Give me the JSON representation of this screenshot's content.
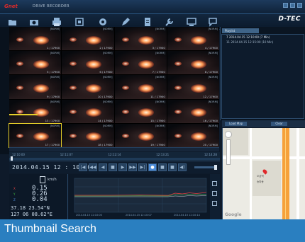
{
  "window": {
    "brand": "Gnet",
    "app_name": "DRIVE RECORDER",
    "logo": "D-TEC"
  },
  "toolbar": {
    "icons": [
      "folder-open-icon",
      "camera-icon",
      "print-icon",
      "snapshot-icon",
      "settings-icon",
      "edit-icon",
      "document-icon",
      "wrench-icon",
      "monitor-icon",
      "chat-icon"
    ]
  },
  "thumbnails": [
    {
      "label": "[NORM]",
      "count": "1 / 17900"
    },
    {
      "label": "[NORM]",
      "count": "2 / 17900"
    },
    {
      "label": "[NORM]",
      "count": "3 / 17900"
    },
    {
      "label": "[NORM]",
      "count": "4 / 17900"
    },
    {
      "label": "[NORM]",
      "count": "5 / 17900"
    },
    {
      "label": "[NORM]",
      "count": "6 / 17900"
    },
    {
      "label": "[NORM]",
      "count": "7 / 17900"
    },
    {
      "label": "[NORM]",
      "count": "8 / 17900"
    },
    {
      "label": "[NORM]",
      "count": "9 / 17900"
    },
    {
      "label": "[NORM]",
      "count": "10 / 17900"
    },
    {
      "label": "[NORM]",
      "count": "11 / 17900"
    },
    {
      "label": "[NORM]",
      "count": "12 / 17900"
    },
    {
      "label": "[NORM]",
      "count": "13 / 17900"
    },
    {
      "label": "[NORM]",
      "count": "14 / 17900"
    },
    {
      "label": "[NORM]",
      "count": "15 / 17900"
    },
    {
      "label": "[NORM]",
      "count": "16 / 17900"
    },
    {
      "label": "[NORM]",
      "count": "17 / 17900"
    },
    {
      "label": "[NORM]",
      "count": "18 / 17900"
    },
    {
      "label": "[NORM]",
      "count": "19 / 17900"
    },
    {
      "label": "[NORM]",
      "count": "20 / 17900"
    }
  ],
  "playlist": {
    "tab": "Playlist",
    "items": [
      "7 2014.04.15 12:10:00 (7 Min)",
      "11 2014.04.15 12:15:00 (10 Min)"
    ]
  },
  "map_bar": {
    "left_button": "Load Map",
    "right_button": "Clear"
  },
  "map": {
    "label1": "오금역",
    "label2": "송파동",
    "watermark": "Google"
  },
  "timeline": {
    "marks": [
      "12:10:00",
      "12:11:07",
      "12:12:14",
      "12:13:21",
      "12:14:28"
    ]
  },
  "playback": {
    "datetime": "2014.04.15 12 : 10:00",
    "buttons": [
      "|◀",
      "◀◀",
      "◀",
      "■",
      "▶",
      "▶▶",
      "▶|",
      "●",
      "■",
      "■",
      "◀)"
    ]
  },
  "gps": {
    "speed_unit": "km/h",
    "x_label": "X",
    "y_label": "Y",
    "z_label": "Z",
    "x_value": "0.15",
    "y_value": "0.26",
    "z_value": "0.04",
    "latitude": "37.18 23.54\"N",
    "longitude": "127 06 08.62\"E",
    "label_colors": {
      "x": "#e04040",
      "y": "#40c040",
      "z": "#4a90e0"
    }
  },
  "graph": {
    "ticks": [
      "2014.04.15 12:10:00",
      "2014.04.15 12:10:07",
      "2014.04.15 12:10:14"
    ]
  },
  "caption": {
    "text": "Thumbnail Search"
  }
}
